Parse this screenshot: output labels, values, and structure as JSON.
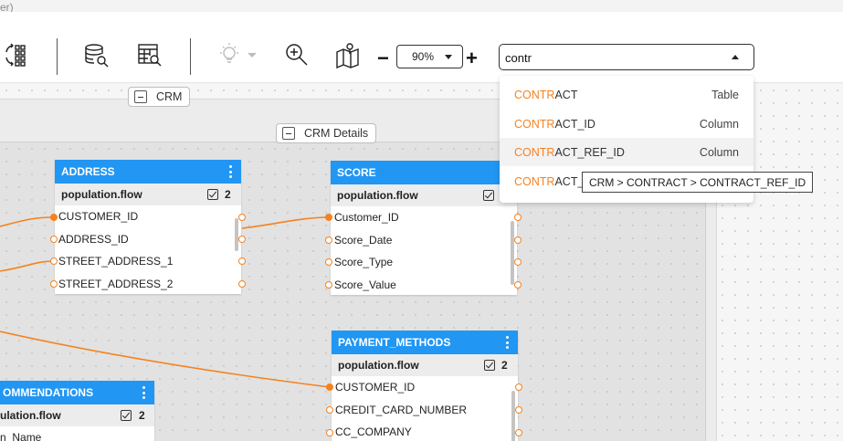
{
  "window": {
    "title_fragment": "er)"
  },
  "toolbar": {
    "icons": [
      "sync-grid-icon",
      "database-search-icon",
      "table-search-icon",
      "lightbulb-icon",
      "zoom-in-icon",
      "map-location-icon"
    ],
    "zoom_minus": "−",
    "zoom_plus": "+",
    "zoom_value": "90%",
    "search_value": "contr"
  },
  "groups": {
    "crm": {
      "label": "CRM"
    },
    "crm_details": {
      "label": "CRM Details"
    }
  },
  "search_results": [
    {
      "match": "CONTR",
      "rest": "ACT",
      "kind": "Table"
    },
    {
      "match": "CONTR",
      "rest": "ACT_ID",
      "kind": "Column"
    },
    {
      "match": "CONTR",
      "rest": "ACT_REF_ID",
      "kind": "Column"
    },
    {
      "match": "CONTR",
      "rest": "ACT_",
      "kind": ""
    }
  ],
  "tooltip": {
    "text": "CRM > CONTRACT > CONTRACT_REF_ID"
  },
  "entities": {
    "address": {
      "title": "ADDRESS",
      "source": "population.flow",
      "count": "2",
      "columns": [
        "CUSTOMER_ID",
        "ADDRESS_ID",
        "STREET_ADDRESS_1",
        "STREET_ADDRESS_2"
      ]
    },
    "score": {
      "title": "SCORE",
      "source": "population.flow",
      "columns": [
        "Customer_ID",
        "Score_Date",
        "Score_Type",
        "Score_Value"
      ]
    },
    "payment_methods": {
      "title": "PAYMENT_METHODS",
      "source": "population.flow",
      "count": "2",
      "columns": [
        "CUSTOMER_ID",
        "CREDIT_CARD_NUMBER",
        "CC_COMPANY"
      ]
    },
    "recommendations": {
      "title": "OMMENDATIONS",
      "source": "ulation.flow",
      "count": "2",
      "columns": [
        "n_Name"
      ]
    }
  },
  "colors": {
    "header_blue": "#2196f3",
    "edge_orange": "#f5821f",
    "match_orange": "#f5821f"
  }
}
